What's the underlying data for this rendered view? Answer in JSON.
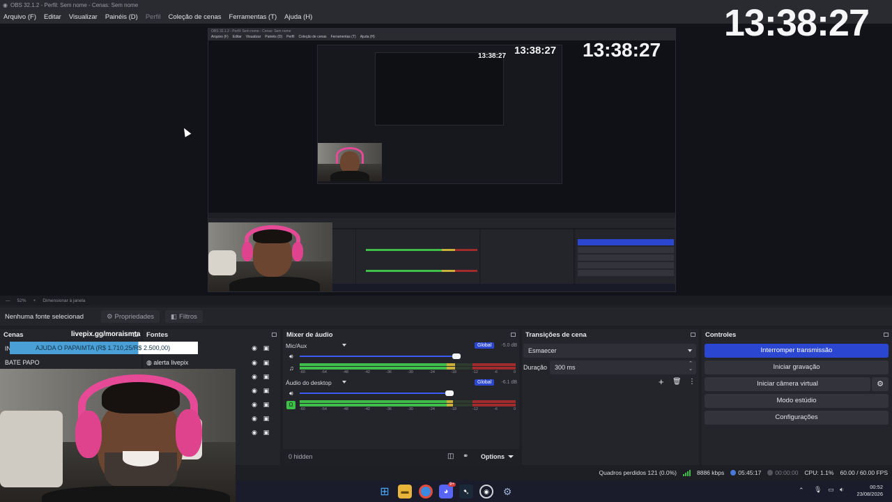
{
  "window": {
    "title": "OBS 32.1.2 - Perfil: Sem nome - Cenas: Sem nome"
  },
  "menu": [
    {
      "label": "Arquivo (F)",
      "disabled": false
    },
    {
      "label": "Editar",
      "disabled": false
    },
    {
      "label": "Visualizar",
      "disabled": false
    },
    {
      "label": "Painéis (D)",
      "disabled": false
    },
    {
      "label": "Perfil",
      "disabled": true
    },
    {
      "label": "Coleção de cenas",
      "disabled": false
    },
    {
      "label": "Ferramentas (T)",
      "disabled": false
    },
    {
      "label": "Ajuda (H)",
      "disabled": false
    }
  ],
  "preview": {
    "clock": "13:38:27",
    "nested_clock": "13:38:27",
    "nested_clock_small": "13:38:27"
  },
  "zoom": {
    "level": "52%",
    "mode": "Dimensionar à janela"
  },
  "source_toolbar": {
    "no_source": "Nenhuma fonte selecionad",
    "properties": "Propriedades",
    "filters": "Filtros"
  },
  "scenes": {
    "title": "Cenas",
    "items": [
      "IN",
      "BATE PAPO"
    ]
  },
  "sources": {
    "title": "Fontes",
    "items": [
      "alerta livepix"
    ]
  },
  "overlay": {
    "livepix_url": "livepix.gg/moraismta",
    "alert_text": "AJUDA O PAPAIMTA (R$ 1.710,25/R$ 2.500,00)",
    "alert_progress": 0.684
  },
  "mixer": {
    "title": "Mixer de áudio",
    "tracks": [
      {
        "name": "Mic/Aux",
        "badge": "Global",
        "db": "-5.0 dB",
        "volume": 0.9,
        "level": 0.72
      },
      {
        "name": "Áudio do desktop",
        "badge": "Global",
        "db": "-6.1 dB",
        "volume": 0.86,
        "level": 0.71
      }
    ],
    "ticks": [
      "-60",
      "-54",
      "-48",
      "-42",
      "-36",
      "-30",
      "-24",
      "-18",
      "-12",
      "-6",
      "0"
    ],
    "hidden": "0 hidden",
    "options": "Options"
  },
  "transitions": {
    "title": "Transições de cena",
    "selected": "Esmaecer",
    "duration_label": "Duração",
    "duration_value": "300 ms"
  },
  "controls": {
    "title": "Controles",
    "buttons": {
      "stop_stream": "Interromper transmissão",
      "start_recording": "Iniciar gravação",
      "virtual_cam": "Iniciar câmera virtual",
      "studio_mode": "Modo estúdio",
      "settings": "Configurações"
    }
  },
  "status": {
    "dropped": "Quadros perdidos 121 (0.0%)",
    "bitrate": "8886 kbps",
    "stream_time": "05:45:17",
    "rec_time": "00:00:00",
    "cpu": "CPU: 1.1%",
    "fps": "60.00 / 60.00 FPS"
  },
  "taskbar": {
    "time": "00:52",
    "date": "23/08/2026",
    "notification_badge": "9+"
  },
  "colors": {
    "accent": "#2b47d1",
    "meter_green": "#3fbf4a",
    "meter_yellow": "#c9b03a",
    "meter_red": "#a12a2a",
    "headphones_pink": "#e64a97"
  }
}
